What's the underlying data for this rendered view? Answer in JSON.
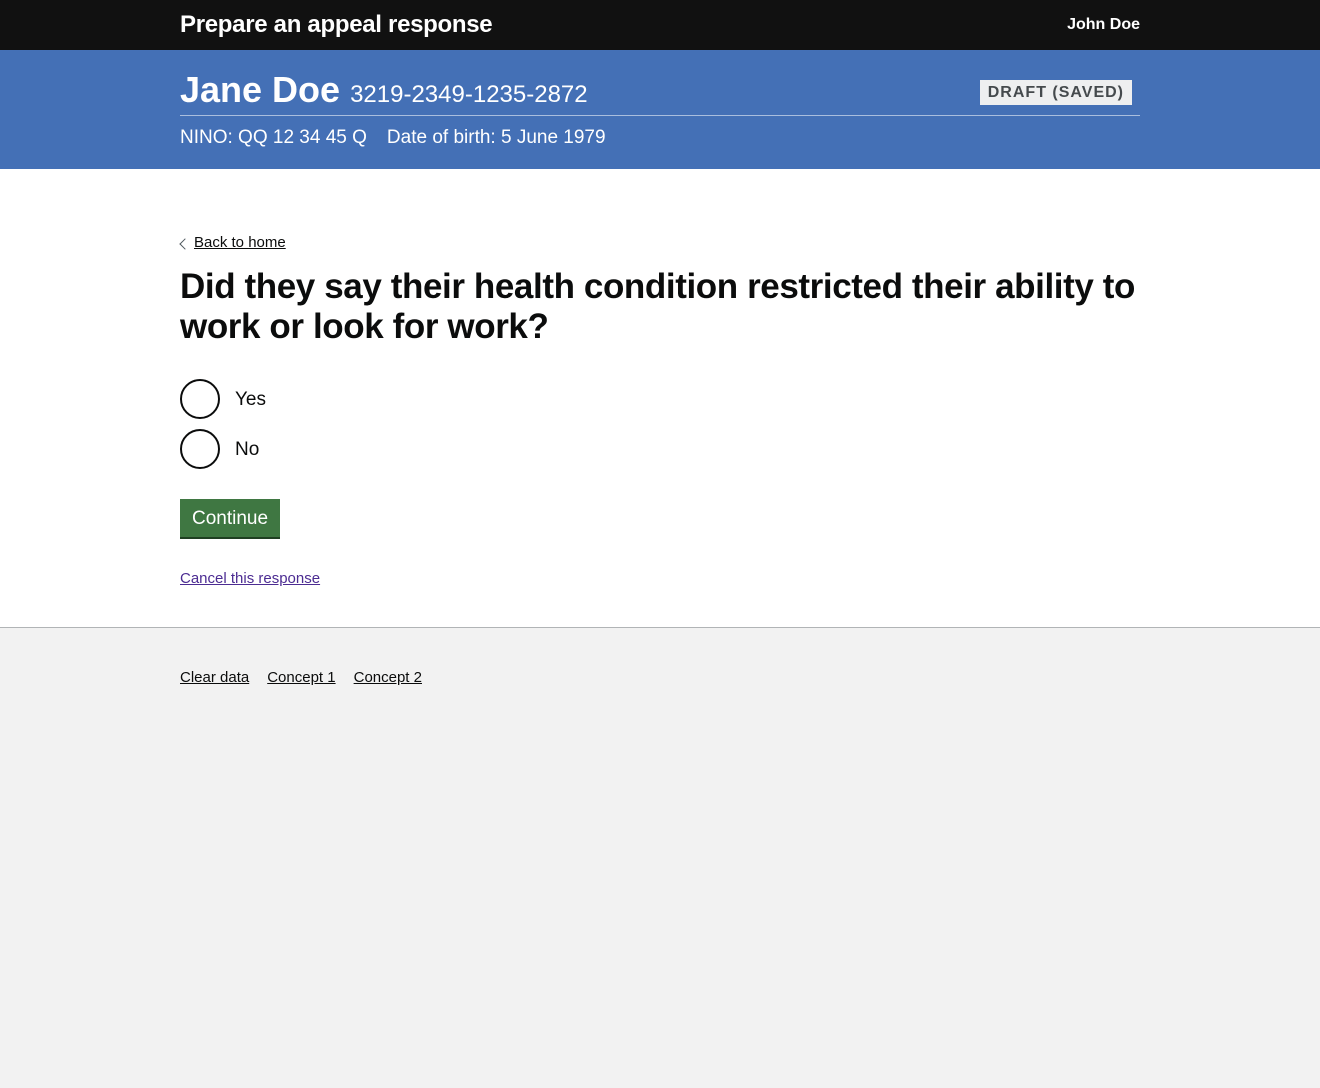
{
  "header": {
    "service_name": "Prepare an appeal response",
    "user_name": "John Doe"
  },
  "case": {
    "claimant_name": "Jane Doe",
    "claim_reference": "3219-2349-1235-2872",
    "status": "DRAFT (SAVED)",
    "nino": "NINO: QQ 12 34 45 Q",
    "date_of_birth": "Date of birth: 5 June 1979"
  },
  "main": {
    "back_link": "Back to home",
    "question": "Did they say their health condition restricted their ability to work or look for work?",
    "options": [
      {
        "label": "Yes",
        "selected": false
      },
      {
        "label": "No",
        "selected": false
      }
    ],
    "continue_label": "Continue",
    "cancel_label": "Cancel this response"
  },
  "footer": {
    "links": [
      "Clear data",
      "Concept 1",
      "Concept 2"
    ]
  },
  "colors": {
    "header_bg": "#111111",
    "banner_bg": "#4470b6",
    "button_bg": "#3f7742",
    "link_visited": "#4c2c92",
    "footer_bg": "#f2f2f2"
  }
}
